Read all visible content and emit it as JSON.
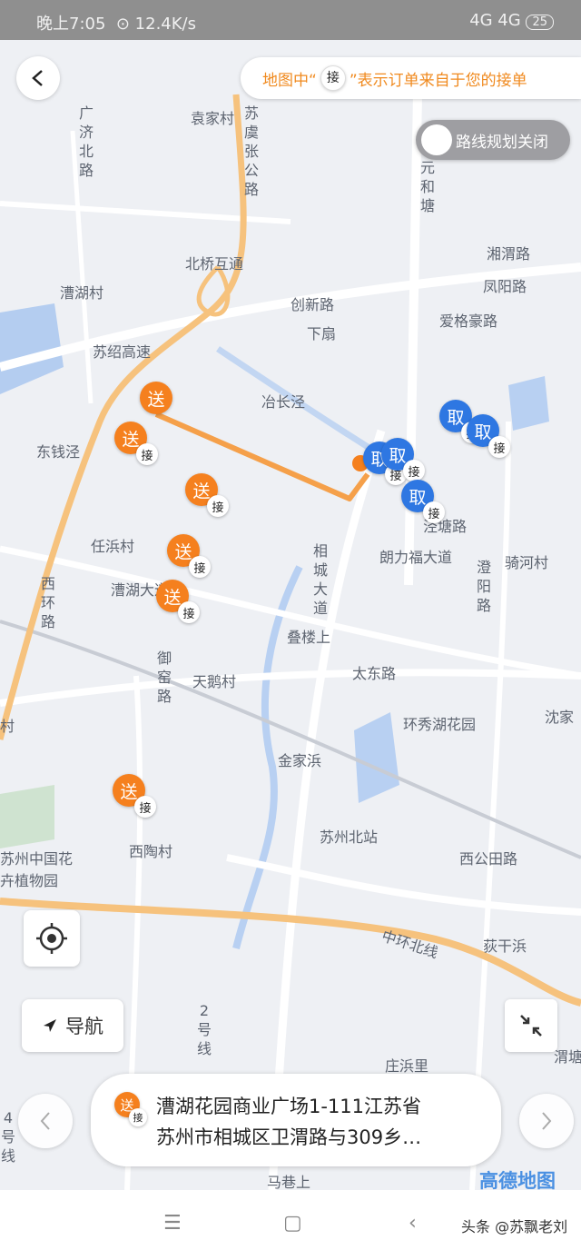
{
  "status_bar": {
    "time": "晚上7:05",
    "speed": "12.4K/s",
    "network": "4G 4G",
    "battery": "25"
  },
  "header": {
    "hint_prefix": "地图中“",
    "hint_tag": "接",
    "hint_suffix": "”表示订单来自于您的接单",
    "route_toggle_label": "路线规划关闭"
  },
  "map_labels": [
    "袁家村",
    "苏虞张公路",
    "广济北路",
    "元和塘",
    "北桥互通",
    "湘渭路",
    "凤阳路",
    "漕湖村",
    "创新路",
    "爱格豪路",
    "下扇",
    "苏绍高速",
    "冶长泾",
    "东钱泾",
    "任浜村",
    "漕湖大道",
    "西环路",
    "相城大道",
    "朗力福大道",
    "骑河村",
    "澄阳路",
    "叠楼上",
    "御窑路",
    "天鹅村",
    "太东路",
    "沈家",
    "环秀湖花园",
    "金家浜",
    "苏州北站",
    "西陶村",
    "苏州中国花卉植物园",
    "西公田路",
    "中环北线",
    "荻干浜",
    "2号线",
    "庄浜里",
    "马巷上",
    "渭塘路",
    "泾塘路",
    "村",
    "4号线"
  ],
  "markers": {
    "deliver_label": "送",
    "pickup_label": "取",
    "badge_label": "接"
  },
  "controls": {
    "nav_label": "导航"
  },
  "address_card": {
    "line1": "漕湖花园商业广场1-111江苏省",
    "line2": "苏州市相城区卫渭路与309乡…"
  },
  "brand": "高德地图",
  "watermark": "头条 @苏飘老刘",
  "colors": {
    "deliver": "#f5801e",
    "pickup": "#2e77e2",
    "route": "#f5a04a",
    "highway": "#f6c27d"
  }
}
